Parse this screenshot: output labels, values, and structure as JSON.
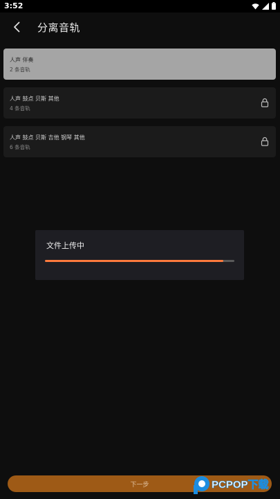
{
  "status_bar": {
    "time": "3:52",
    "icons": [
      "wifi-icon",
      "signal-icon",
      "battery-icon"
    ]
  },
  "header": {
    "back_icon": "chevron-left-icon",
    "title": "分离音轨"
  },
  "options": [
    {
      "title": "人声 伴奏",
      "subtitle": "2 条音轨",
      "selected": true,
      "locked": false
    },
    {
      "title": "人声 鼓点 贝斯 其他",
      "subtitle": "4 条音轨",
      "selected": false,
      "locked": true
    },
    {
      "title": "人声 鼓点 贝斯 吉他 钢琴 其他",
      "subtitle": "6 条音轨",
      "selected": false,
      "locked": true
    }
  ],
  "dialog": {
    "title": "文件上传中",
    "progress": 0.94
  },
  "footer": {
    "next_label": "下一步"
  },
  "watermark": {
    "text": "PCPOP下载"
  },
  "colors": {
    "accent": "#ff7a3d",
    "button": "#9e5a16",
    "selected_card": "#a5a5a5"
  }
}
